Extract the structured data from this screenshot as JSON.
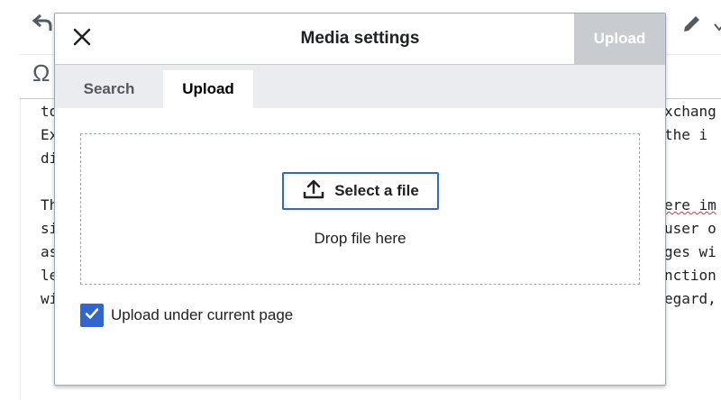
{
  "background": {
    "toolbar_icons": [
      "undo-icon",
      "omega-icon",
      "edit-pencil-icon",
      "chevron-down-icon"
    ],
    "left_fragments": [
      "to",
      "Ex",
      "di",
      "",
      "Th",
      "si",
      "as",
      "le",
      "wi"
    ],
    "right_fragments": [
      "xchang",
      "the i",
      "",
      "",
      "ere im",
      "user o",
      "ges wi",
      "nction",
      "egard,"
    ]
  },
  "dialog": {
    "title": "Media settings",
    "close_icon": "close-icon",
    "primary_button": "Upload",
    "tabs": [
      {
        "label": "Search",
        "active": false
      },
      {
        "label": "Upload",
        "active": true
      }
    ],
    "select_button": {
      "icon": "upload-icon",
      "label": "Select a file"
    },
    "drop_text": "Drop file here",
    "checkbox": {
      "label": "Upload under current page",
      "checked": true
    }
  },
  "colors": {
    "accent": "#3366cc",
    "disabled_button": "#c8ccd1",
    "tab_bar": "#eaecf0"
  }
}
